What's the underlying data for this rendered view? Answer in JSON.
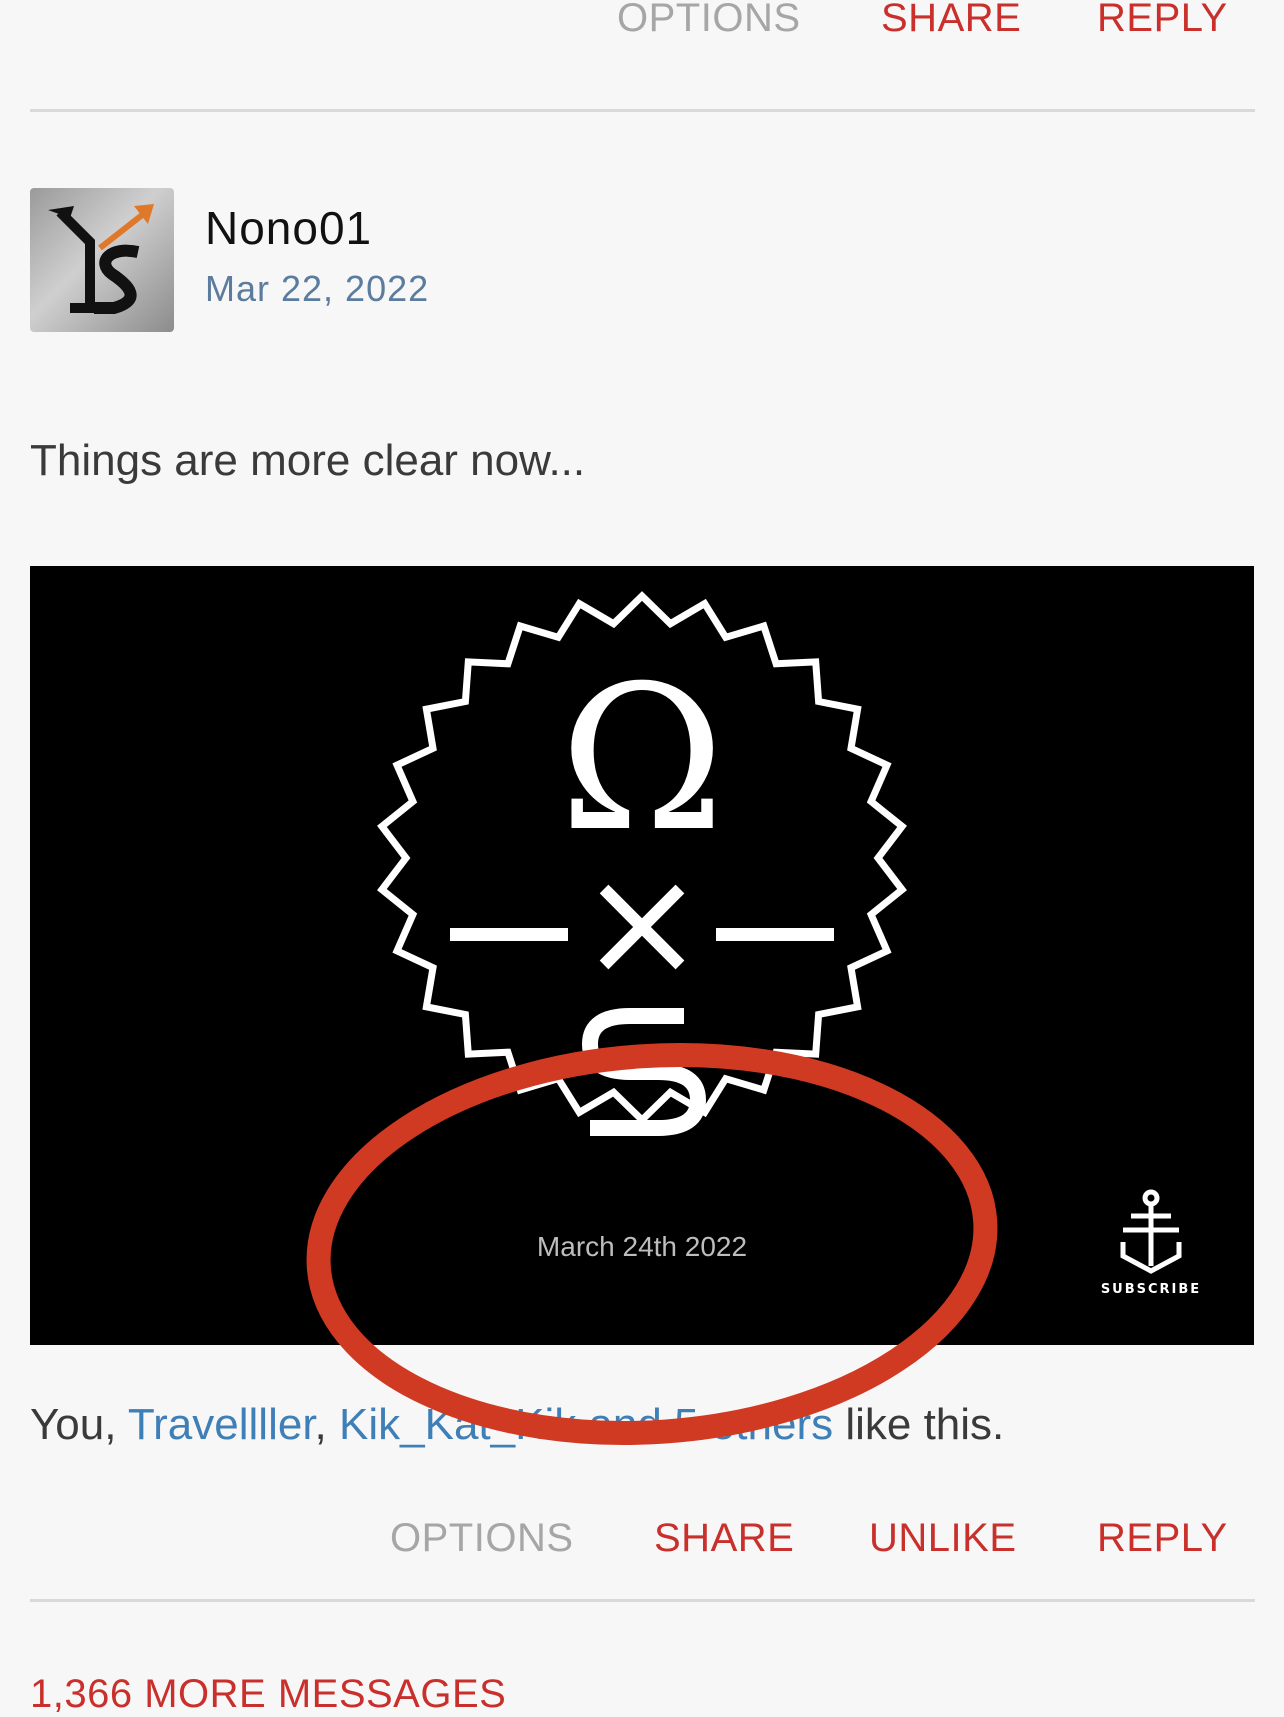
{
  "top_actions": {
    "options": "OPTIONS",
    "share": "SHARE",
    "reply": "REPLY"
  },
  "post": {
    "username": "Nono01",
    "date": "Mar 22, 2022",
    "text": "Things are more clear now...",
    "media": {
      "omega_symbol": "Ω",
      "cross_symbol": "×",
      "event_date": "March 24th 2022",
      "subscribe_label": "SUBSCRIBE"
    },
    "likes": {
      "prefix": "You, ",
      "user1": "Travellller",
      "sep": ", ",
      "user2": "Kik_Kat_Kik",
      "and": " and ",
      "others": "5 others",
      "suffix": " like this."
    },
    "actions": {
      "options": "OPTIONS",
      "share": "SHARE",
      "unlike": "UNLIKE",
      "reply": "REPLY"
    }
  },
  "more_messages": "1,366 MORE MESSAGES",
  "colors": {
    "accent_red": "#c9302c",
    "link_blue": "#3f7fb7",
    "date_blue": "#5b7c9d",
    "annotation_red": "#d13a22"
  }
}
